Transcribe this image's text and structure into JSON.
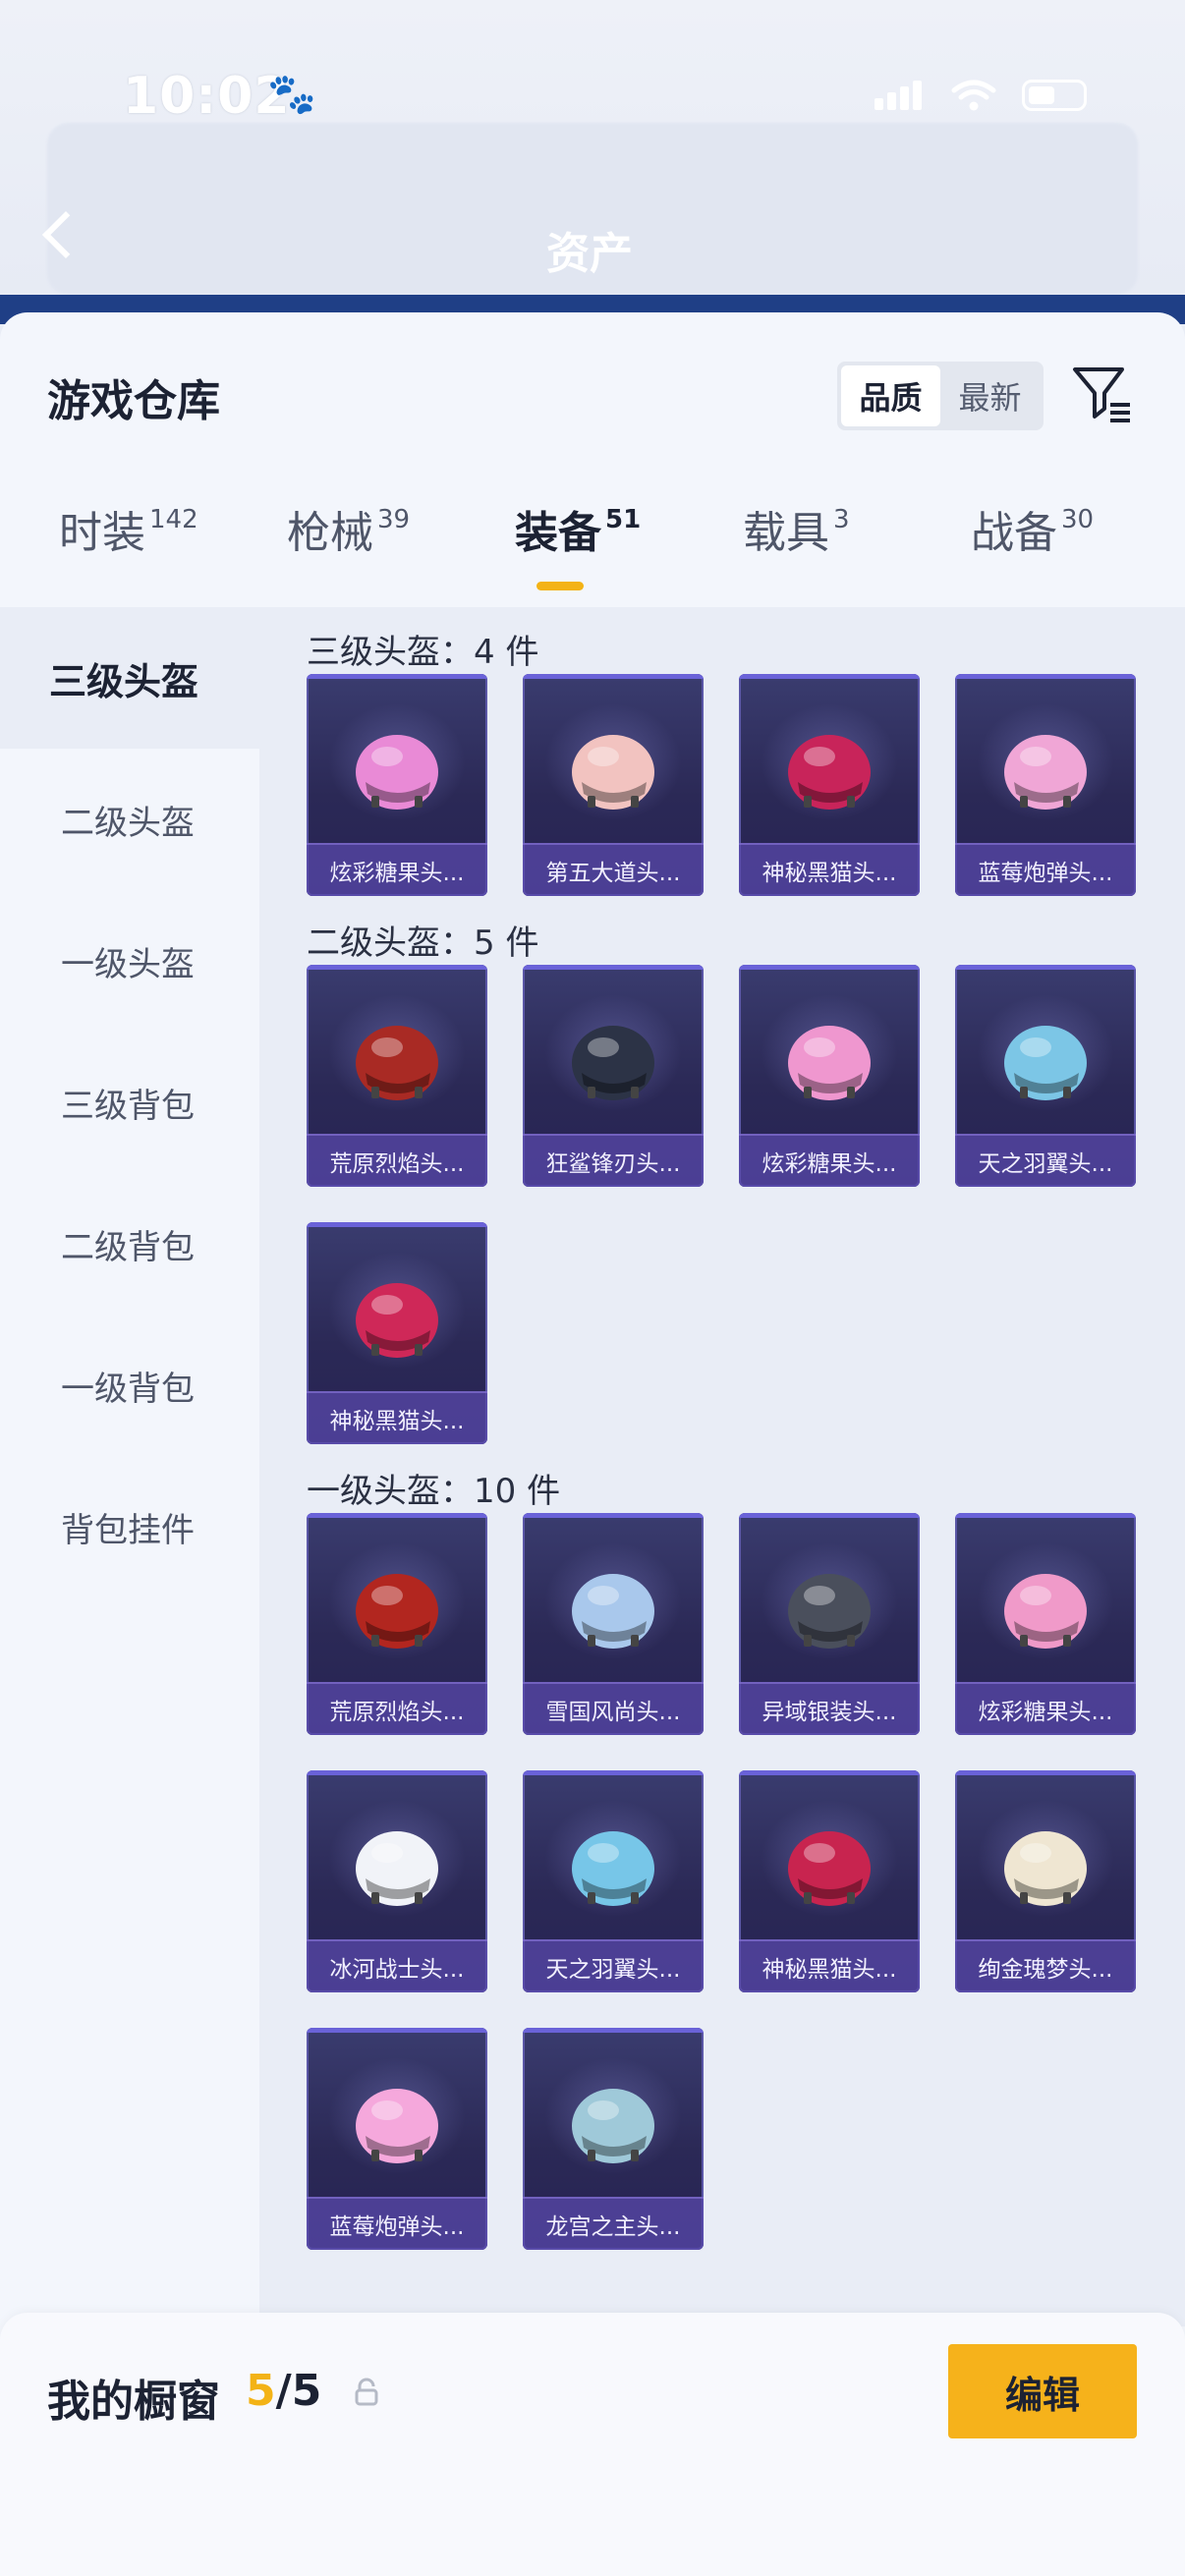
{
  "status_bar": {
    "time": "10:02"
  },
  "header": {
    "asset_title": "资产"
  },
  "sheet": {
    "title": "游戏仓库",
    "sort": {
      "quality": "品质",
      "newest": "最新",
      "active": "quality"
    }
  },
  "tabs": [
    {
      "label": "时装",
      "count": "142"
    },
    {
      "label": "枪械",
      "count": "39"
    },
    {
      "label": "装备",
      "count": "51",
      "active": true
    },
    {
      "label": "载具",
      "count": "3"
    },
    {
      "label": "战备",
      "count": "30"
    }
  ],
  "sidenav": [
    {
      "label": "三级头盔",
      "active": true
    },
    {
      "label": "二级头盔"
    },
    {
      "label": "一级头盔"
    },
    {
      "label": "三级背包"
    },
    {
      "label": "二级背包"
    },
    {
      "label": "一级背包"
    },
    {
      "label": "背包挂件"
    }
  ],
  "sections": [
    {
      "title": "三级头盔：4 件",
      "items": [
        {
          "name": "炫彩糖果头...",
          "color": "#e98ad6"
        },
        {
          "name": "第五大道头...",
          "color": "#f2c3c0"
        },
        {
          "name": "神秘黑猫头...",
          "color": "#c8245a"
        },
        {
          "name": "蓝莓炮弹头...",
          "color": "#f0a6d6"
        }
      ]
    },
    {
      "title": "二级头盔：5 件",
      "items": [
        {
          "name": "荒原烈焰头...",
          "color": "#a92a24"
        },
        {
          "name": "狂鲨锋刃头...",
          "color": "#2c3346"
        },
        {
          "name": "炫彩糖果头...",
          "color": "#ef97cf"
        },
        {
          "name": "天之羽翼头...",
          "color": "#7cc6e6"
        },
        {
          "name": "神秘黑猫头...",
          "color": "#cf2858"
        }
      ]
    },
    {
      "title": "一级头盔：10 件",
      "items": [
        {
          "name": "荒原烈焰头...",
          "color": "#b2261f"
        },
        {
          "name": "雪国风尚头...",
          "color": "#a9c8ec"
        },
        {
          "name": "异域银装头...",
          "color": "#4a4f5c"
        },
        {
          "name": "炫彩糖果头...",
          "color": "#f09ac9"
        },
        {
          "name": "冰河战士头...",
          "color": "#f1f3f8"
        },
        {
          "name": "天之羽翼头...",
          "color": "#77c6e8"
        },
        {
          "name": "神秘黑猫头...",
          "color": "#c8244f"
        },
        {
          "name": "绚金瑰梦头...",
          "color": "#efe6d2"
        },
        {
          "name": "蓝莓炮弹头...",
          "color": "#f5a8dc"
        },
        {
          "name": "龙宫之主头...",
          "color": "#9fc9d9"
        }
      ]
    }
  ],
  "bottom_bar": {
    "showcase_label": "我的橱窗",
    "showcase_current": "5",
    "showcase_total": "/5",
    "edit_label": "编辑"
  },
  "colors": {
    "accent": "#f6b21b",
    "card_bg": "#2b2956",
    "header_blue": "#1f3f86"
  }
}
